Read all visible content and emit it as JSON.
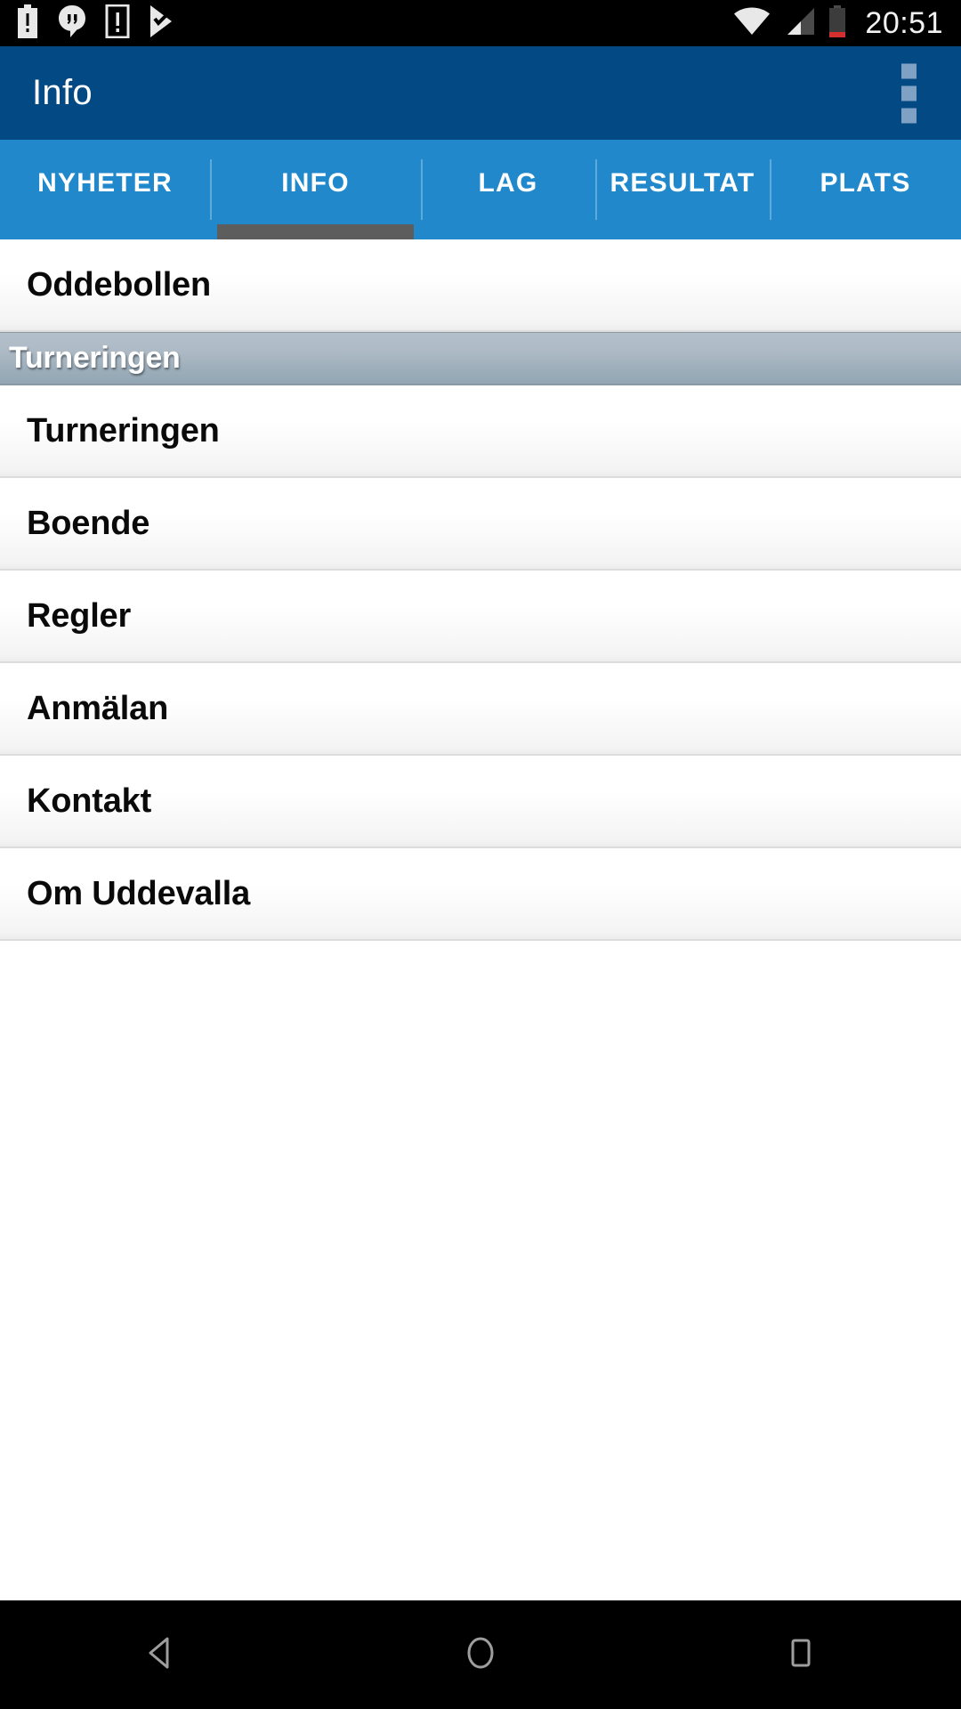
{
  "status_bar": {
    "time": "20:51",
    "left_icons": [
      {
        "name": "battery-alert-icon",
        "glyph": "battery-alert"
      },
      {
        "name": "hangouts-icon",
        "glyph": "hangouts"
      },
      {
        "name": "sim-alert-icon",
        "glyph": "sim-alert"
      },
      {
        "name": "play-store-update-icon",
        "glyph": "play-check"
      }
    ],
    "right_icons": [
      {
        "name": "wifi-icon",
        "glyph": "wifi-full"
      },
      {
        "name": "cellular-signal-icon",
        "glyph": "signal-partial"
      },
      {
        "name": "battery-low-icon",
        "glyph": "battery-low"
      }
    ],
    "colors": {
      "background": "#000000",
      "foreground": "#f2f2f2",
      "battery_low": "#d32f2f"
    }
  },
  "app_bar": {
    "title": "Info",
    "overflow_menu_label": "More options",
    "colors": {
      "background": "#034a85",
      "title": "#ffffff",
      "overflow_dots": "#7fa2c4"
    }
  },
  "tab_bar": {
    "active_index": 1,
    "tabs": [
      {
        "label": "NYHETER"
      },
      {
        "label": "INFO"
      },
      {
        "label": "LAG"
      },
      {
        "label": "RESULTAT"
      },
      {
        "label": "PLATS"
      }
    ],
    "colors": {
      "background": "#2189cb",
      "label": "#ffffff",
      "indicator": "#5d5d5d",
      "divider": "rgba(255,255,255,0.28)"
    }
  },
  "content": {
    "rows": [
      {
        "type": "item",
        "label": "Oddebollen"
      },
      {
        "type": "header",
        "label": "Turneringen"
      },
      {
        "type": "item",
        "label": "Turneringen"
      },
      {
        "type": "item",
        "label": "Boende"
      },
      {
        "type": "item",
        "label": "Regler"
      },
      {
        "type": "item",
        "label": "Anmälan"
      },
      {
        "type": "item",
        "label": "Kontakt"
      },
      {
        "type": "item",
        "label": "Om Uddevalla"
      }
    ],
    "colors": {
      "item_text": "#0a0a0a",
      "header_text": "#ffffff",
      "divider": "#dcdcdc"
    }
  },
  "nav_bar": {
    "buttons": [
      {
        "name": "back",
        "label": "Back"
      },
      {
        "name": "home",
        "label": "Home"
      },
      {
        "name": "recents",
        "label": "Recent apps"
      }
    ],
    "colors": {
      "background": "#000000",
      "icon": "#9e9e9e"
    }
  }
}
